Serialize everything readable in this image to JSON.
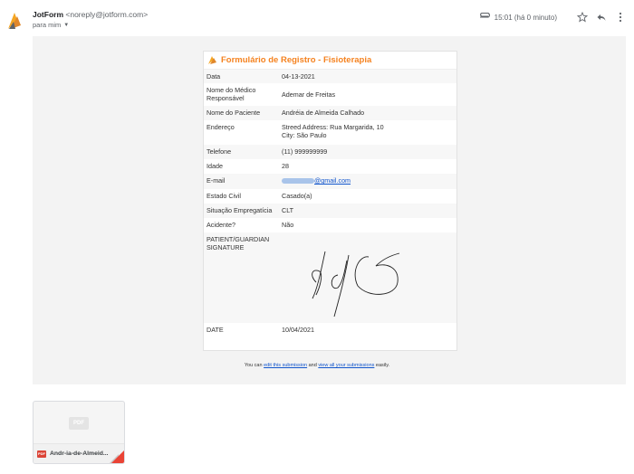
{
  "email": {
    "sender_name": "JotForm",
    "sender_address": "<noreply@jotform.com>",
    "recipient": "para mim",
    "time": "15:01 (há 0 minuto)"
  },
  "form": {
    "title": "Formulário de Registro - Fisioterapia",
    "rows": [
      {
        "label": "Data",
        "value": "04-13-2021"
      },
      {
        "label": "Nome do Médico Responsável",
        "value": "Ademar de Freitas"
      },
      {
        "label": "Nome do Paciente",
        "value": "Andréia de Almeida Calhado"
      },
      {
        "label": "Endereço",
        "value": "Streed Address: Rua Margarida, 10",
        "value2": "City: São Paulo"
      },
      {
        "label": "Telefone",
        "value": "(11) 999999999"
      },
      {
        "label": "Idade",
        "value": "28"
      },
      {
        "label": "E-mail",
        "value": "@gmail.com"
      },
      {
        "label": "Estado Civil",
        "value": "Casado(a)"
      },
      {
        "label": "Situação Empregatícia",
        "value": "CLT"
      },
      {
        "label": "Acidente?",
        "value": "Não"
      },
      {
        "label": "PATIENT/GUARDIAN SIGNATURE",
        "value": ""
      },
      {
        "label": "DATE",
        "value": "10/04/2021"
      }
    ]
  },
  "footer": {
    "prefix": "You can ",
    "edit_link": "edit this submission",
    "middle": " and ",
    "view_link": "view all your submissions",
    "suffix": " easily."
  },
  "attachment": {
    "thumb_label": "PDF",
    "badge": "PDF",
    "name": "Andr-ia-de-Almeid..."
  },
  "colors": {
    "brand_orange": "#f5821f",
    "link_blue": "#1155cc",
    "pdf_red": "#db4437"
  }
}
